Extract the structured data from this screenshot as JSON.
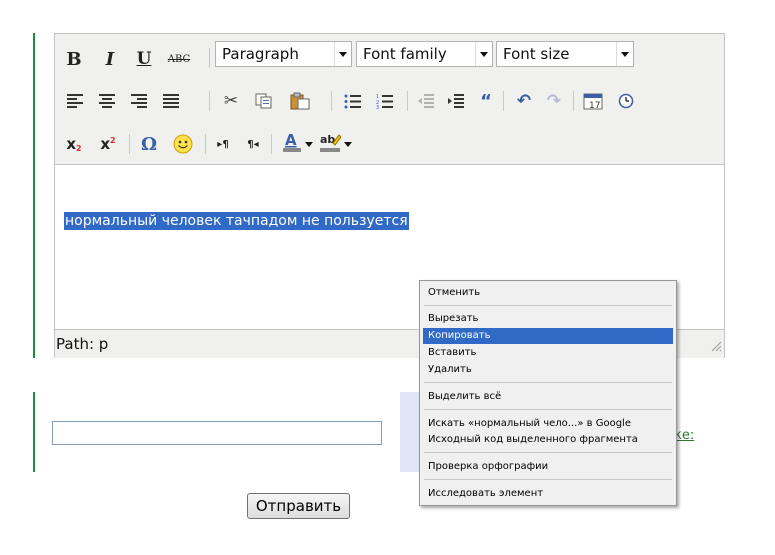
{
  "toolbar": {
    "format_select": "Paragraph",
    "font_family_select": "Font family",
    "font_size_select": "Font size"
  },
  "editor": {
    "content_text": "нормальный человек тачпадом не пользуется",
    "path_label": "Path: p"
  },
  "form": {
    "link_text": "ке:",
    "submit_label": "Отправить",
    "input_value": ""
  },
  "context_menu": {
    "items": [
      {
        "label": "Отменить",
        "highlighted": false
      },
      {
        "label": "Вырезать",
        "highlighted": false
      },
      {
        "label": "Копировать",
        "highlighted": true
      },
      {
        "label": "Вставить",
        "highlighted": false
      },
      {
        "label": "Удалить",
        "highlighted": false
      },
      {
        "label": "Выделить всё",
        "highlighted": false
      },
      {
        "label": "Искать «нормальный чело...» в Google",
        "highlighted": false
      },
      {
        "label": "Исходный код выделенного фрагмента",
        "highlighted": false
      },
      {
        "label": "Проверка орфографии",
        "highlighted": false
      },
      {
        "label": "Исследовать элемент",
        "highlighted": false
      }
    ]
  },
  "colors": {
    "selection": "#3169c6",
    "left_bar": "#1c8a3c",
    "toolbar_bg": "#f0f0ee",
    "link": "#2a7b2a"
  }
}
